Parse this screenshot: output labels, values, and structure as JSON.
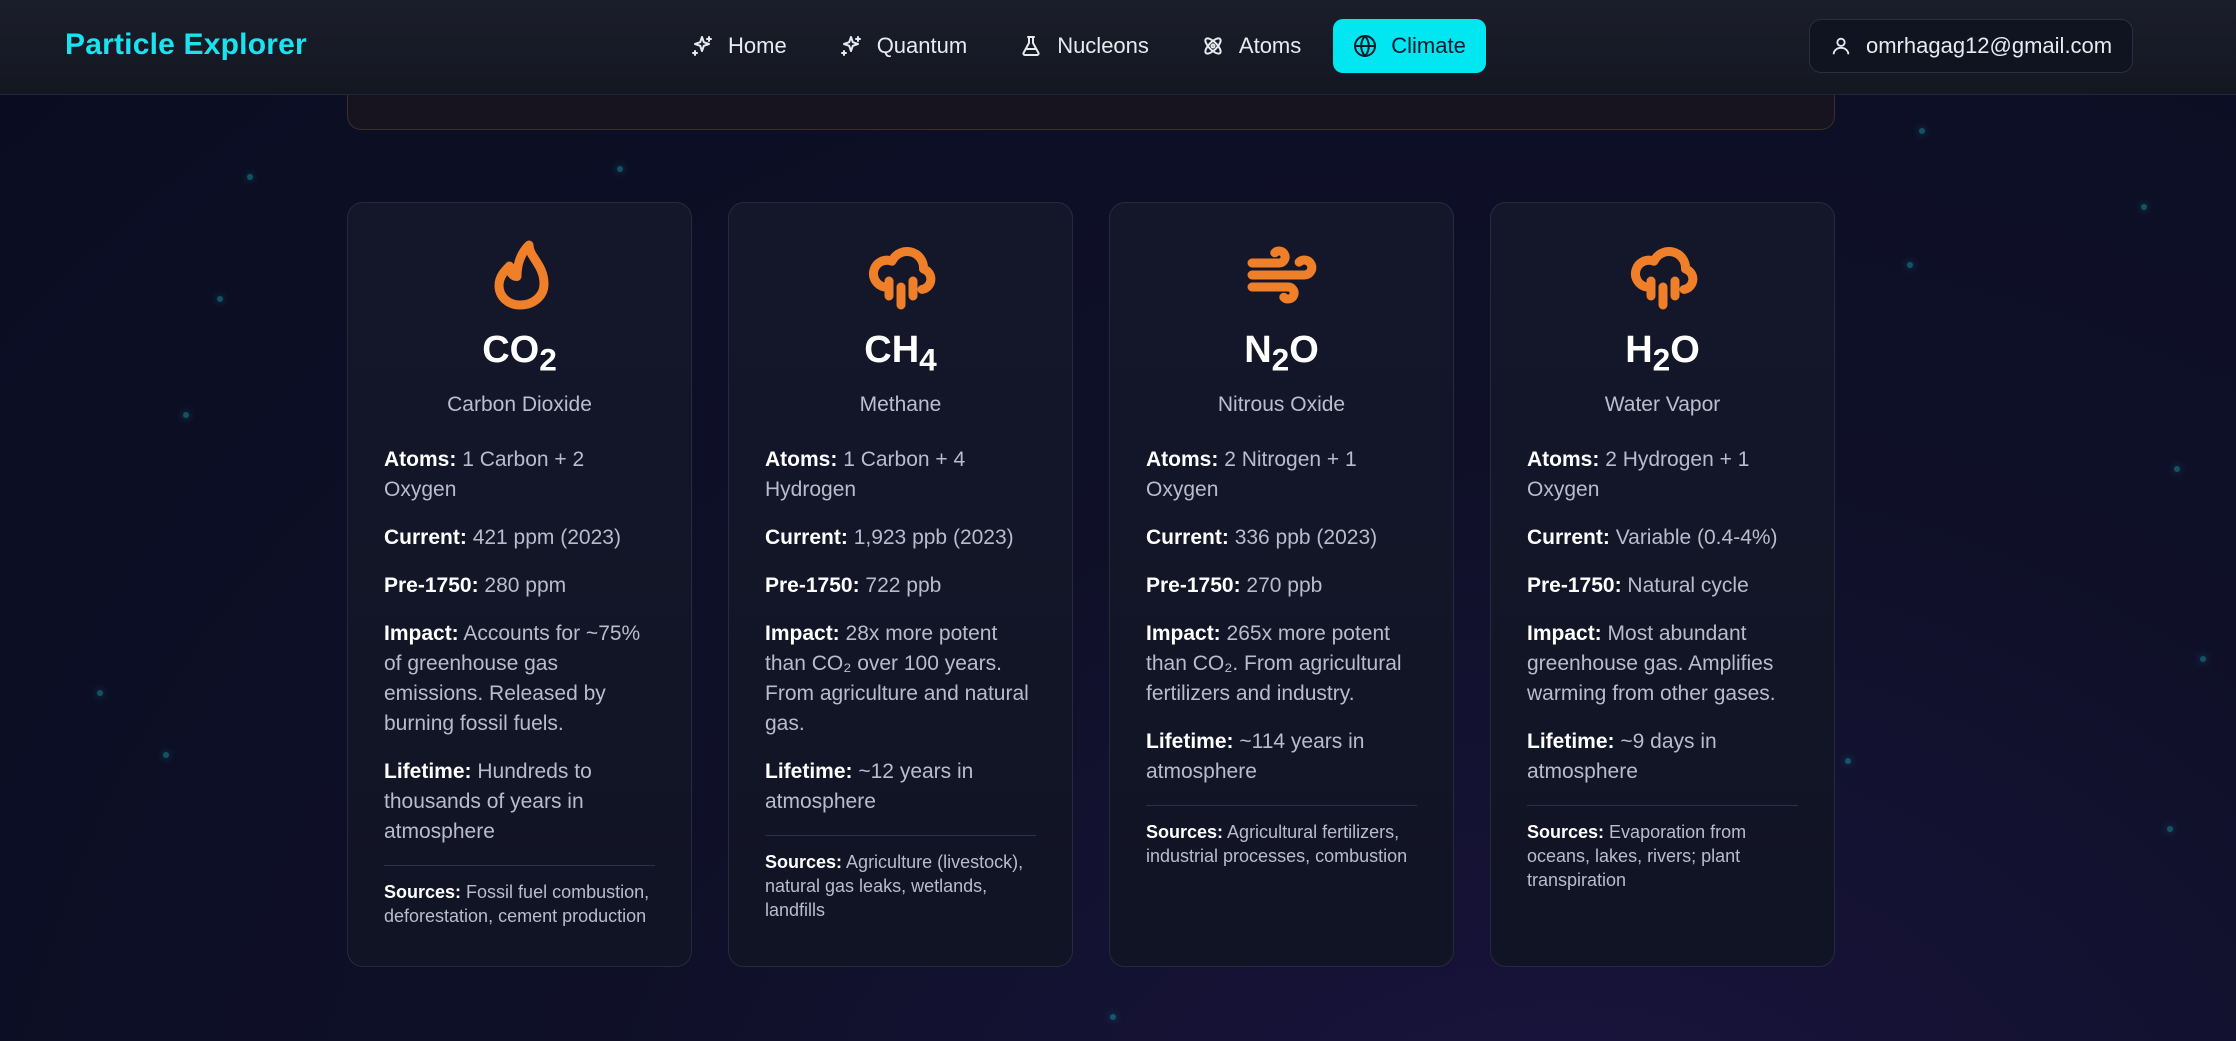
{
  "brand": "Particle Explorer",
  "nav": [
    {
      "label": "Home",
      "icon": "sparkles-icon"
    },
    {
      "label": "Quantum",
      "icon": "sparkles-icon"
    },
    {
      "label": "Nucleons",
      "icon": "flask-icon"
    },
    {
      "label": "Atoms",
      "icon": "atom-icon"
    },
    {
      "label": "Climate",
      "icon": "globe-icon",
      "active": true
    }
  ],
  "user": {
    "email": "omrhagag12@gmail.com",
    "icon": "user-icon"
  },
  "colors": {
    "accent": "#00e7f2",
    "brand": "#19e3ef",
    "icon": "#f07f2a"
  },
  "labels": {
    "atoms": "Atoms:",
    "current": "Current:",
    "pre1750": "Pre-1750:",
    "impact": "Impact:",
    "lifetime": "Lifetime:",
    "sources": "Sources:"
  },
  "cards": [
    {
      "icon": "flame-icon",
      "formula_base": "CO",
      "formula_sub": "2",
      "formula_tail": "",
      "name": "Carbon Dioxide",
      "atoms": "1 Carbon + 2 Oxygen",
      "current": "421 ppm (2023)",
      "pre1750": "280 ppm",
      "impact": "Accounts for ~75% of greenhouse gas emissions. Released by burning fossil fuels.",
      "lifetime": "Hundreds to thousands of years in atmosphere",
      "sources": "Fossil fuel combustion, deforestation, cement production"
    },
    {
      "icon": "cloud-rain-icon",
      "formula_base": "CH",
      "formula_sub": "4",
      "formula_tail": "",
      "name": "Methane",
      "atoms": "1 Carbon + 4 Hydrogen",
      "current": "1,923 ppb (2023)",
      "pre1750": "722 ppb",
      "impact": "28x more potent than CO₂ over 100 years. From agriculture and natural gas.",
      "lifetime": "~12 years in atmosphere",
      "sources": "Agriculture (livestock), natural gas leaks, wetlands, landfills"
    },
    {
      "icon": "wind-icon",
      "formula_base": "N",
      "formula_sub": "2",
      "formula_tail": "O",
      "name": "Nitrous Oxide",
      "atoms": "2 Nitrogen + 1 Oxygen",
      "current": "336 ppb (2023)",
      "pre1750": "270 ppb",
      "impact": "265x more potent than CO₂. From agricultural fertilizers and industry.",
      "lifetime": "~114 years in atmosphere",
      "sources": "Agricultural fertilizers, industrial processes, combustion"
    },
    {
      "icon": "cloud-rain-icon",
      "formula_base": "H",
      "formula_sub": "2",
      "formula_tail": "O",
      "name": "Water Vapor",
      "atoms": "2 Hydrogen + 1 Oxygen",
      "current": "Variable (0.4-4%)",
      "pre1750": "Natural cycle",
      "impact": "Most abundant greenhouse gas. Amplifies warming from other gases.",
      "lifetime": "~9 days in atmosphere",
      "sources": "Evaporation from oceans, lakes, rivers; plant transpiration"
    }
  ]
}
